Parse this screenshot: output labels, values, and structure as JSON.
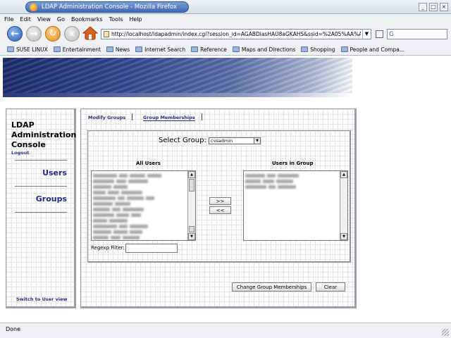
{
  "window": {
    "title": "LDAP Administration Console - Mozilla Firefox"
  },
  "menu": [
    "File",
    "Edit",
    "View",
    "Go",
    "Bookmarks",
    "Tools",
    "Help"
  ],
  "toolbar": {
    "url": "http://localhost/ldapadmin/index.cgi?session_id=AGABDlasHAU8aGKAHS&ssid=%2A05%AA%A"
  },
  "bookmarks": [
    "SUSE LINUX",
    "Entertainment",
    "News",
    "Internet Search",
    "Reference",
    "Maps and Directions",
    "Shopping",
    "People and Compa..."
  ],
  "sidebar": {
    "app_name_line1": "LDAP",
    "app_name_line2": "Administration",
    "app_name_line3": "Console",
    "logout": "Logout",
    "users": "Users",
    "groups": "Groups",
    "switch_view": "Switch to User view"
  },
  "main": {
    "tabs": [
      "Modify Groups",
      "Group Memberships"
    ],
    "select_group_label": "Select Group:",
    "select_group_value": "cvsadmin",
    "all_users_title": "All Users",
    "users_in_group_title": "Users in Group",
    "add_button": ">>",
    "remove_button": "<<",
    "regexp_label": "Regexp Filter:",
    "change_button": "Change Group Memberships",
    "clear_button": "Clear"
  },
  "status": {
    "text": "Done"
  }
}
